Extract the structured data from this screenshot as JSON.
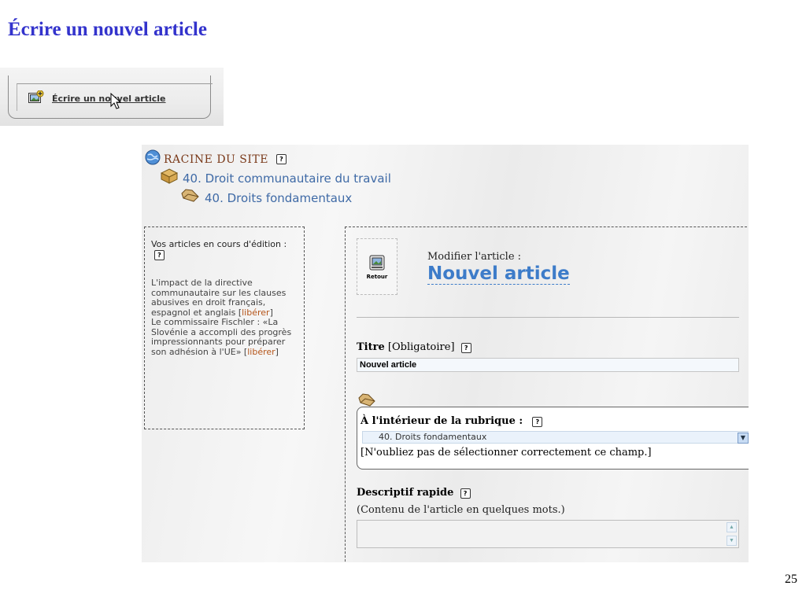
{
  "slide": {
    "title": "Écrire un nouvel article",
    "page_number": "25"
  },
  "new_article_button": {
    "label": "Écrire un nouvel article"
  },
  "hierarchy": {
    "root": "RACINE DU SITE",
    "help": "?",
    "sector": "40. Droit communautaire du travail",
    "section": "40. Droits fondamentaux"
  },
  "sidebar": {
    "heading": "Vos articles en cours d'édition :",
    "help": "?",
    "articles": [
      {
        "title": "L'impact de la directive communautaire sur les clauses abusives en droit français, espagnol et anglais",
        "free_label": "libérer"
      },
      {
        "title": "Le commissaire Fischler : «La Slovénie a accompli des progrès impressionnants pour préparer son adhésion à l'UE»",
        "free_label": "libérer"
      }
    ]
  },
  "editor": {
    "back_label": "Retour",
    "modify_label": "Modifier l'article :",
    "article_name": "Nouvel article",
    "title_field": {
      "label": "Titre",
      "required": "[Obligatoire]",
      "help": "?",
      "value": "Nouvel article"
    },
    "rubric": {
      "label": "À l'intérieur de la rubrique :",
      "help": "?",
      "selected": "40. Droits fondamentaux",
      "note": "[N'oubliez pas de sélectionner correctement ce champ.]"
    },
    "description": {
      "label": "Descriptif rapide",
      "help": "?",
      "hint": "(Contenu de l'article en quelques mots.)",
      "value": ""
    }
  },
  "colors": {
    "slide_title": "#3333cc",
    "link_blue": "#3f6aa6",
    "article_title": "#3d7cc9",
    "free_link": "#b5551a",
    "root_label": "#7a3a1a"
  }
}
